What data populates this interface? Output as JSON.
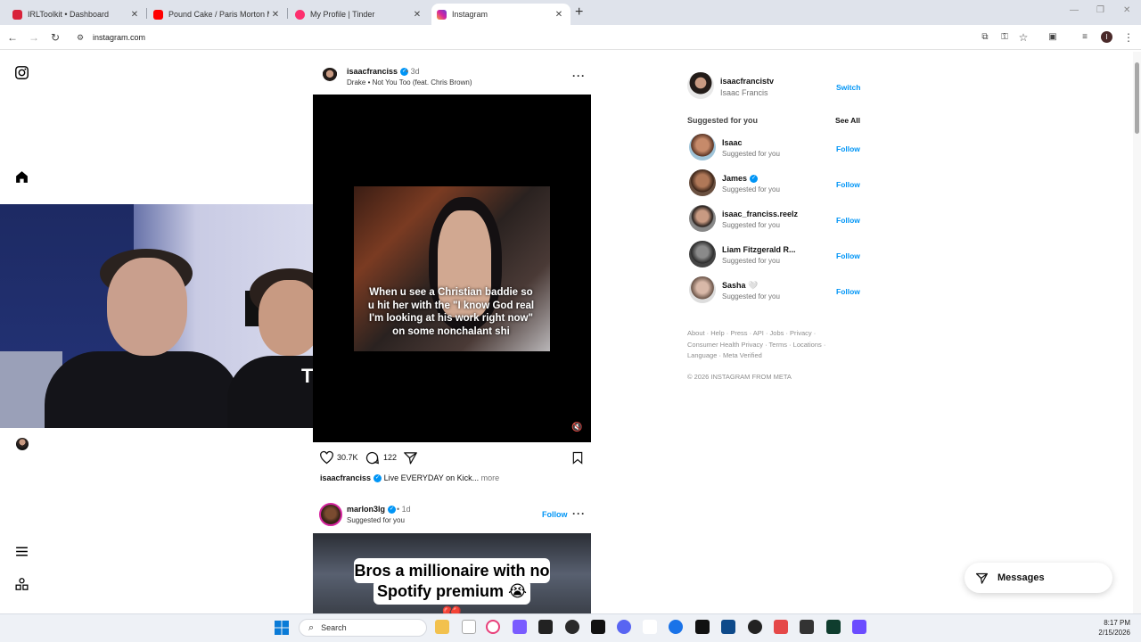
{
  "browser": {
    "tabs": [
      {
        "title": "IRLToolkit • Dashboard",
        "color": "#d8233a"
      },
      {
        "title": "Pound Cake / Paris Morton Mu",
        "color": "#ff0000"
      },
      {
        "title": "My Profile | Tinder",
        "color": "#fd2f6e"
      },
      {
        "title": "Instagram",
        "color": "#d6249f"
      }
    ],
    "url": "instagram.com",
    "profile_initial": "I"
  },
  "feed": {
    "post1": {
      "username": "isaacfranciss",
      "time": "3d",
      "audio": "Drake • Not You Too (feat. Chris Brown)",
      "caption_overlay": "When u see a Christian baddie so u hit her with the \"I know God real I'm looking at his work right now\" on some nonchalant shi",
      "likes": "30.7K",
      "comments": "122",
      "caption_user": "isaacfranciss",
      "caption_text": "Live EVERYDAY on Kick...",
      "more": "more"
    },
    "post2": {
      "username": "marlon3lg",
      "time": "1d",
      "sub": "Suggested for you",
      "follow": "Follow",
      "overlay_line1": "Bros a millionaire with no",
      "overlay_line2": "Spotify premium 😭💔"
    }
  },
  "sidebar": {
    "account": {
      "username": "isaacfrancistv",
      "name": "Isaac Francis",
      "switch": "Switch"
    },
    "suggested_title": "Suggested for you",
    "see_all": "See All",
    "suggestions": [
      {
        "name": "Isaac",
        "sub": "Suggested for you",
        "action": "Follow",
        "verified": false
      },
      {
        "name": "James",
        "sub": "Suggested for you",
        "action": "Follow",
        "verified": true
      },
      {
        "name": "isaac_franciss.reelz",
        "sub": "Suggested for you",
        "action": "Follow",
        "verified": false
      },
      {
        "name": "Liam Fitzgerald R...",
        "sub": "Suggested for you",
        "action": "Follow",
        "verified": false
      },
      {
        "name": "Sasha 🤍",
        "sub": "Suggested for you",
        "action": "Follow",
        "verified": false
      }
    ],
    "footer": "About · Help · Press · API · Jobs · Privacy · Consumer Health Privacy · Terms · Locations · Language · Meta Verified",
    "copyright": "© 2026 INSTAGRAM FROM META"
  },
  "messages_label": "Messages",
  "taskbar": {
    "search_placeholder": "Search",
    "time": "8:17 PM",
    "date": "2/15/2026"
  },
  "icons": {
    "brand": "instagram-icon",
    "home": "home-icon",
    "menu": "hamburger-icon",
    "more": "more-dots-icon"
  }
}
